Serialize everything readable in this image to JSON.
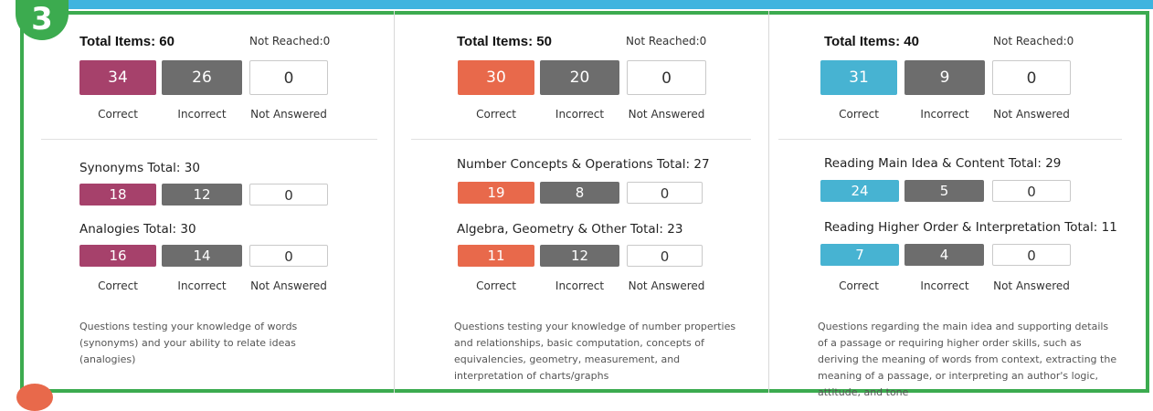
{
  "step_number": "3",
  "colors": {
    "verbal": "#a6416b",
    "quantitative": "#e8694b",
    "reading": "#47b3d2",
    "incorrect": "#6d6d6d",
    "frame_green": "#3cab4f",
    "top_bar_blue": "#3fb4df"
  },
  "labels": {
    "correct": "Correct",
    "incorrect": "Incorrect",
    "not_answered": "Not Answered"
  },
  "columns": [
    {
      "total": "Total Items: 60",
      "not_reached": "Not Reached:0",
      "correct": "34",
      "incorrect": "26",
      "not_answered": "0",
      "subsections": [
        {
          "title": "Synonyms Total: 30",
          "correct": "18",
          "incorrect": "12",
          "not_answered": "0"
        },
        {
          "title": "Analogies Total: 30",
          "correct": "16",
          "incorrect": "14",
          "not_answered": "0"
        }
      ],
      "description": "Questions testing your knowledge of words (synonyms) and your ability to relate ideas (analogies)"
    },
    {
      "total": "Total Items: 50",
      "not_reached": "Not Reached:0",
      "correct": "30",
      "incorrect": "20",
      "not_answered": "0",
      "subsections": [
        {
          "title": "Number Concepts & Operations Total: 27",
          "correct": "19",
          "incorrect": "8",
          "not_answered": "0"
        },
        {
          "title": "Algebra, Geometry & Other Total: 23",
          "correct": "11",
          "incorrect": "12",
          "not_answered": "0"
        }
      ],
      "description": "Questions testing your knowledge of number properties and relationships, basic computation, concepts of equivalencies, geometry, measurement, and interpretation of charts/graphs"
    },
    {
      "total": "Total Items: 40",
      "not_reached": "Not Reached:0",
      "correct": "31",
      "incorrect": "9",
      "not_answered": "0",
      "subsections": [
        {
          "title": "Reading Main Idea & Content Total: 29",
          "correct": "24",
          "incorrect": "5",
          "not_answered": "0"
        },
        {
          "title": "Reading Higher Order & Interpretation Total: 11",
          "correct": "7",
          "incorrect": "4",
          "not_answered": "0"
        }
      ],
      "description": "Questions regarding the main idea and supporting details of a passage or requiring higher order skills, such as deriving the meaning of words from context, extracting the meaning of a passage, or interpreting an author's logic, attitude, and tone"
    }
  ]
}
